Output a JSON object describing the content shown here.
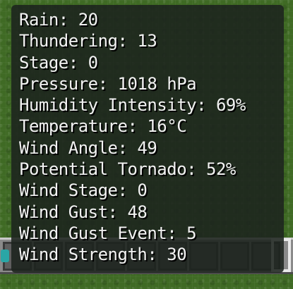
{
  "weather_info": {
    "lines": [
      "Rain: 20",
      "Thundering: 13",
      "Stage: 0",
      "Pressure: 1018 hPa",
      "Humidity Intensity: 69%",
      "Temperature: 16°C",
      "Wind Angle: 49",
      "Potential Tornado: 52%",
      "Wind Stage: 0",
      "Wind Gust: 48",
      "Wind Gust Event: 5",
      "Wind Strength: 30"
    ]
  },
  "colors": {
    "text": "#f2f2f2",
    "panel_bg": "#1c231e",
    "grass": "#3f6a24",
    "hotbar": "#8a8a8a"
  },
  "icons": {
    "hotbar_left_item": "cyan-item-icon"
  }
}
